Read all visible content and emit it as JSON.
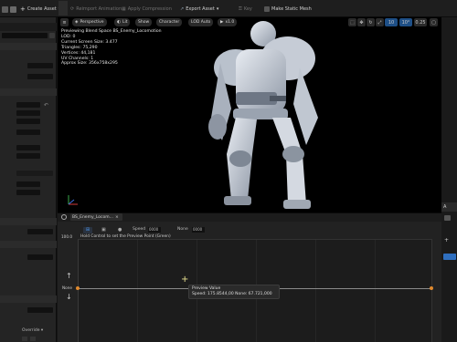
{
  "toolbar": {
    "create_asset": "Create Asset",
    "reimport_animation": "Reimport Animation",
    "apply_compression": "Apply Compression",
    "export_asset": "Export Asset",
    "key": "Key",
    "make_static_mesh": "Make Static Mesh"
  },
  "viewport": {
    "perspective": "Perspective",
    "lit": "Lit",
    "show": "Show",
    "character": "Character",
    "lod_auto": "LOD Auto",
    "speed": "x1.0",
    "grid_snap": "10",
    "rotation_snap": "10°",
    "scale_snap": "0.25",
    "stats": [
      "Previewing Blend Space BS_Enemy_Locomotion",
      "LOD: 0",
      "Current Screen Size: 3.477",
      "Triangles: 75,290",
      "Vertices: 44,181",
      "UV Channels: 1",
      "Approx Size: 356x758x295"
    ]
  },
  "blendspace": {
    "tab_label": "BS_Enemy_Locom...",
    "speed_label": "Speed",
    "speed_value": "0000",
    "none_label": "None",
    "none_value": "0000",
    "hint": "Hold Control to set the Preview Point (Green)",
    "axis_top": "100.0",
    "axis_mid": "None",
    "tooltip_title": "Preview Value",
    "tooltip_value": "Speed: 175.8544,00  None: 67.721,000"
  },
  "leftpanel": {
    "override_label": "Override"
  },
  "colors": {
    "accent": "#3d8fe0",
    "sample_point": "#e08a2e",
    "checkbox_blue": "#2f6fbf"
  }
}
